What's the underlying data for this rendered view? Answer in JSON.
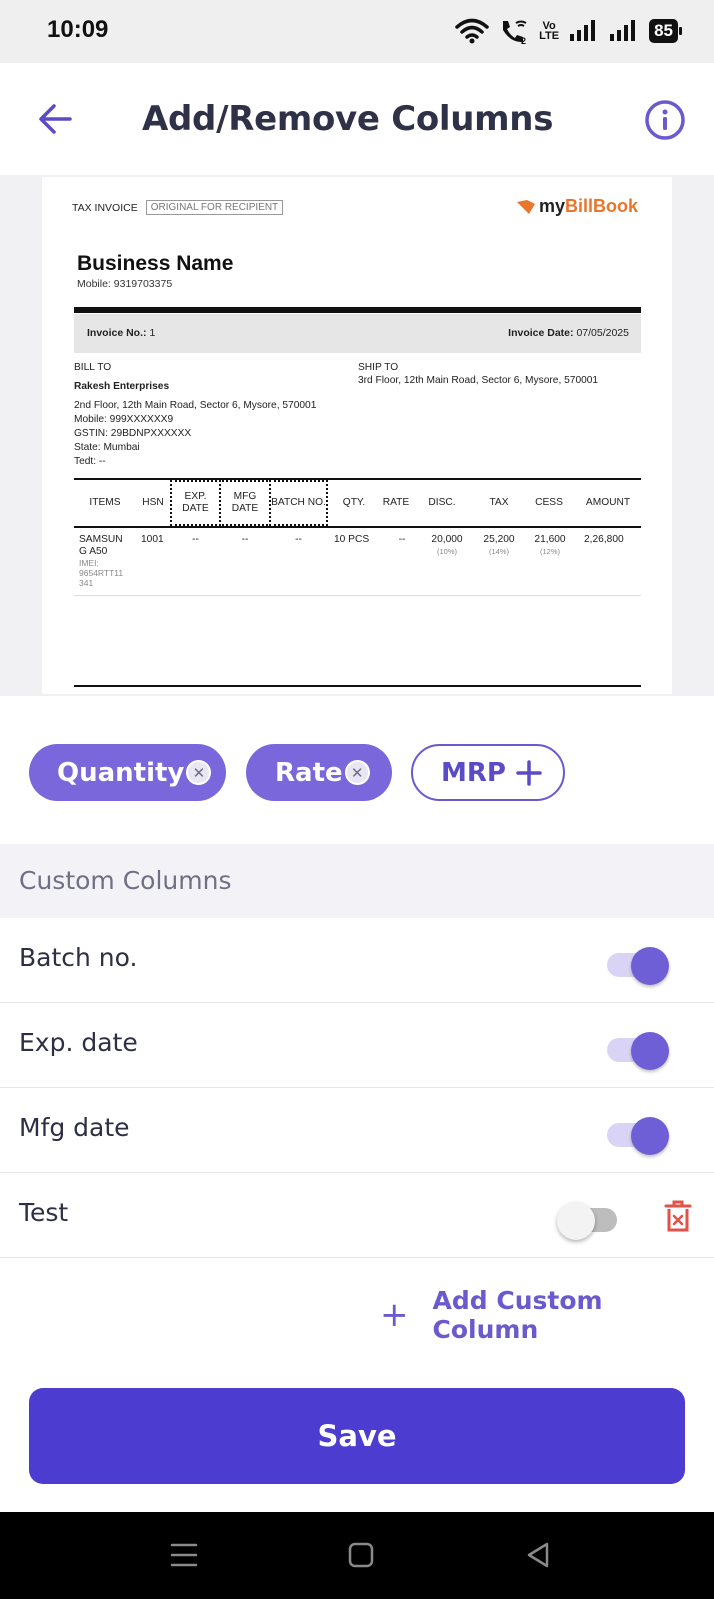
{
  "status_bar": {
    "time": "10:09",
    "volte_top": "Vo",
    "volte_bottom": "LTE",
    "battery": "85"
  },
  "header": {
    "title": "Add/Remove Columns"
  },
  "invoice": {
    "tax_invoice_label": "TAX INVOICE",
    "original_tag": "ORIGINAL FOR RECIPIENT",
    "logo_prefix": "my",
    "logo_suffix": "BillBook",
    "business_name": "Business Name",
    "business_mobile": "Mobile:  9319703375",
    "invoice_no_label": "Invoice No.:",
    "invoice_no": "1",
    "invoice_date_label": "Invoice Date:",
    "invoice_date": "07/05/2025",
    "bill_to": {
      "heading": "BILL TO",
      "name": "Rakesh Enterprises",
      "address": "2nd Floor, 12th Main Road, Sector 6, Mysore, 570001",
      "mobile": "Mobile:  999XXXXXX9",
      "gstin": "GSTIN:    29BDNPXXXXXX",
      "state": "State:  Mumbai",
      "tedt": "Tedt:  --"
    },
    "ship_to": {
      "heading": "SHIP TO",
      "address": "3rd Floor, 12th Main Road, Sector 6, Mysore, 570001"
    },
    "columns": {
      "items": "ITEMS",
      "hsn": "HSN",
      "exp_date": "EXP. DATE",
      "mfg_date": "MFG DATE",
      "batch_no": "BATCH NO.",
      "qty": "QTY.",
      "rate": "RATE",
      "disc": "DISC.",
      "tax": "TAX",
      "cess": "CESS",
      "amount": "AMOUNT"
    },
    "row": {
      "item": "SAMSUN G A50",
      "imei": "IMEI: 9654RTT11 341",
      "hsn": "1001",
      "exp_date": "--",
      "mfg_date": "--",
      "batch_no": "--",
      "qty": "10 PCS",
      "rate": "--",
      "disc": "20,000",
      "disc_pct": "(10%)",
      "tax": "25,200",
      "tax_pct": "(14%)",
      "cess": "21,600",
      "cess_pct": "(12%)",
      "amount": "2,26,800"
    }
  },
  "chips": [
    {
      "label": "Quantity",
      "state": "selected"
    },
    {
      "label": "Rate",
      "state": "selected"
    },
    {
      "label": "MRP",
      "state": "add"
    }
  ],
  "custom_columns": {
    "title": "Custom Columns",
    "items": [
      {
        "label": "Batch no.",
        "enabled": true
      },
      {
        "label": "Exp. date",
        "enabled": true
      },
      {
        "label": "Mfg date",
        "enabled": true
      },
      {
        "label": "Test",
        "enabled": false
      }
    ],
    "add_label": "Add Custom Column"
  },
  "save_label": "Save",
  "colors": {
    "accent": "#4c3ccf",
    "chip": "#7a67dc",
    "delete": "#e0524a"
  }
}
